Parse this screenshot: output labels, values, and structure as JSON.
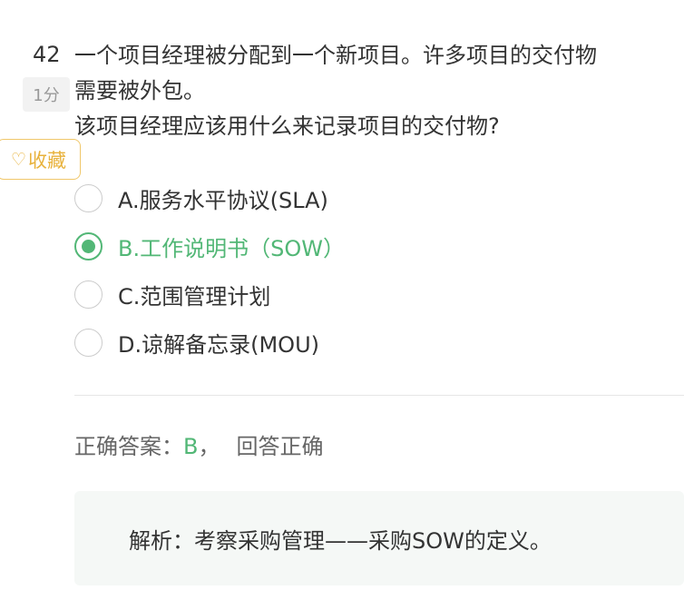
{
  "question": {
    "number": "42",
    "score": "1分",
    "lines": [
      "一个项目经理被分配到一个新项目。许多项目的交付物",
      "需要被外包。",
      "该项目经理应该用什么来记录项目的交付物?"
    ]
  },
  "favorite": {
    "icon": "heart-icon",
    "label": "收藏"
  },
  "options": [
    {
      "label": "A.服务水平协议(SLA)",
      "selected": false
    },
    {
      "label": "B.工作说明书（SOW）",
      "selected": true
    },
    {
      "label": "C.范围管理计划",
      "selected": false
    },
    {
      "label": "D.谅解备忘录(MOU)",
      "selected": false
    }
  ],
  "answer": {
    "prefix": "正确答案：",
    "letter": "B",
    "separator": "，",
    "result": "回答正确"
  },
  "analysis": {
    "text": "解析：考察采购管理——采购SOW的定义。"
  },
  "colors": {
    "accent_green": "#52b776",
    "favorite_gold": "#e8b23c"
  }
}
